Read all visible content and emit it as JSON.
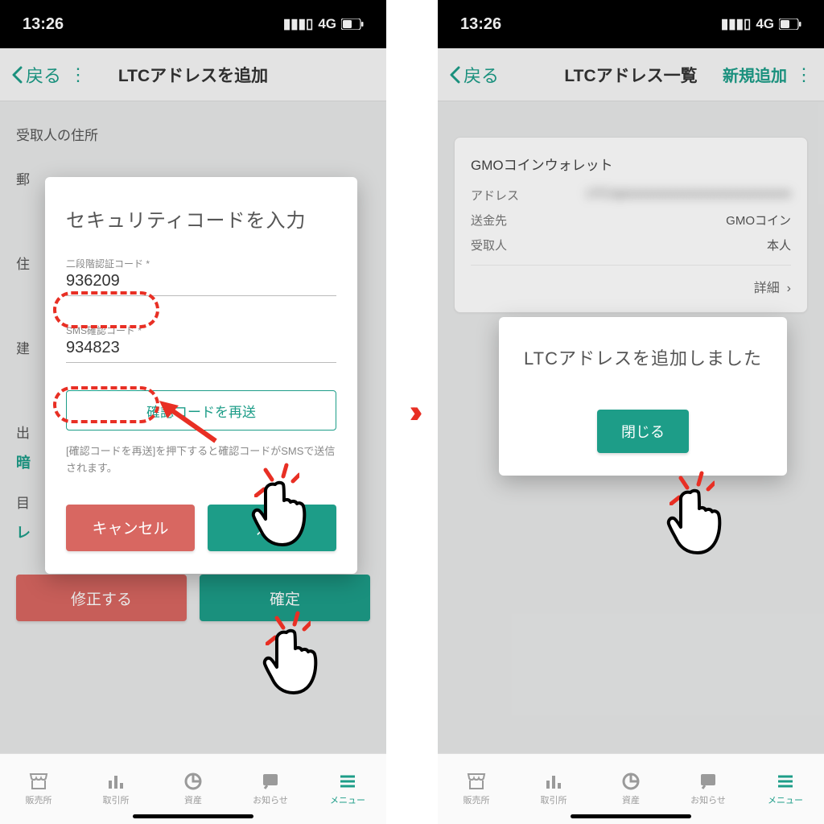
{
  "status": {
    "time": "13:26",
    "network": "4G"
  },
  "tabs": [
    {
      "label": "販売所"
    },
    {
      "label": "取引所"
    },
    {
      "label": "資産"
    },
    {
      "label": "お知らせ"
    },
    {
      "label": "メニュー"
    }
  ],
  "left": {
    "header": {
      "back": "戻る",
      "title": "LTCアドレスを追加"
    },
    "bg": {
      "section": "受取人の住所",
      "f1": "郵",
      "f2": "住",
      "f3": "建",
      "f4": "出",
      "crypto": "暗",
      "f5": "目",
      "lending": "レ",
      "edit": "修正する",
      "confirm": "確定"
    },
    "modal": {
      "title": "セキュリティコードを入力",
      "label1": "二段階認証コード *",
      "value1": "936209",
      "label2": "SMS確認コード *",
      "value2": "934823",
      "resend": "確認コードを再送",
      "help": "[確認コードを再送]を押下すると確認コードがSMSで送信されます。",
      "cancel": "キャンセル",
      "submit": "送信"
    }
  },
  "right": {
    "header": {
      "back": "戻る",
      "title": "LTCアドレス一覧",
      "action": "新規追加"
    },
    "card": {
      "title": "GMOコインウォレット",
      "r1k": "アドレス",
      "r2k": "送金先",
      "r2v": "GMOコイン",
      "r3k": "受取人",
      "r3v": "本人",
      "detail": "詳細"
    },
    "modal": {
      "title": "LTCアドレスを追加しました",
      "close": "閉じる"
    }
  }
}
